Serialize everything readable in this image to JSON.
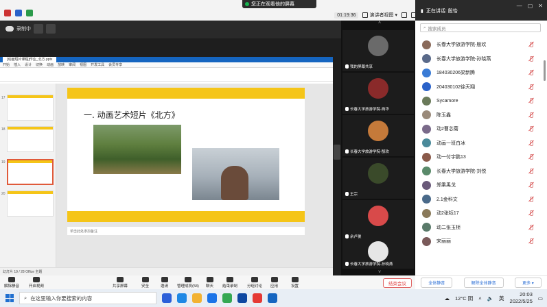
{
  "status_banner": {
    "text": "您正在观看他的屏幕"
  },
  "top_controls": {
    "timer": "01:19:36",
    "view_label": "演讲者视图"
  },
  "recording": {
    "label": "录制中"
  },
  "wps": {
    "doc_tab": "[动画短片课程]作业_北方.pptx",
    "menu": [
      "开始",
      "插入",
      "设计",
      "切换",
      "动画",
      "放映",
      "审阅",
      "视图",
      "开发工具",
      "会员专享"
    ],
    "thumbnail_numbers": [
      "17",
      "18",
      "19",
      "20"
    ],
    "slide_title": "一. 动画艺术短片《北方》",
    "notes_placeholder": "单击此处添加备注",
    "status_text": "幻灯片 19 / 28   Office 主题"
  },
  "video_tiles": [
    {
      "name": "我的屏幕共享",
      "color": "#6a6a6a"
    },
    {
      "name": "长春大学旅游学院-商华",
      "color": "#8a2a2a"
    },
    {
      "name": "长春大学旅游学院-殷欢",
      "color": "#c57a3a"
    },
    {
      "name": "王宗",
      "color": "#3a4a2a"
    },
    {
      "name": "余卢俊",
      "color": "#d84a4a"
    },
    {
      "name": "长春大学旅游学院-孙晓燕",
      "color": "#e6e6e6"
    }
  ],
  "panel": {
    "speaker": "正在讲话: 殷怡",
    "search_placeholder": "搜索成员",
    "participants": [
      "长春大学旅游学院-殷欢",
      "长春大学旅游学院-孙晓燕",
      "184030206梁新腾",
      "204030102徐天翔",
      "Sycamore",
      "陈玉鑫",
      "动2曹芯菊",
      "动画一班白冰",
      "动一付宇鹏13",
      "长春大学旅游学院-刘悦",
      "郑乘禹戈",
      "2.1金科文",
      "动2张钰17",
      "动二张玉桢",
      "宋丽丽"
    ],
    "mute_all": "全体静音",
    "unmute_all": "解除全体静音",
    "more": "更多 ▾"
  },
  "toolbar": {
    "unmute": "解除静音",
    "video": "开启视频",
    "share": "共享屏幕",
    "security": "安全",
    "invite": "邀请",
    "manage": "管理成员(58)",
    "chat": "聊天",
    "record": "结束录制",
    "breakout": "分组讨论",
    "apps": "应用",
    "settings": "设置",
    "end": "结束会议"
  },
  "taskbar": {
    "search_placeholder": "在这里输入你要搜索的内容",
    "weather": "12°C 阴",
    "ime": "英",
    "time": "20:03",
    "date": "2022/5/25"
  }
}
